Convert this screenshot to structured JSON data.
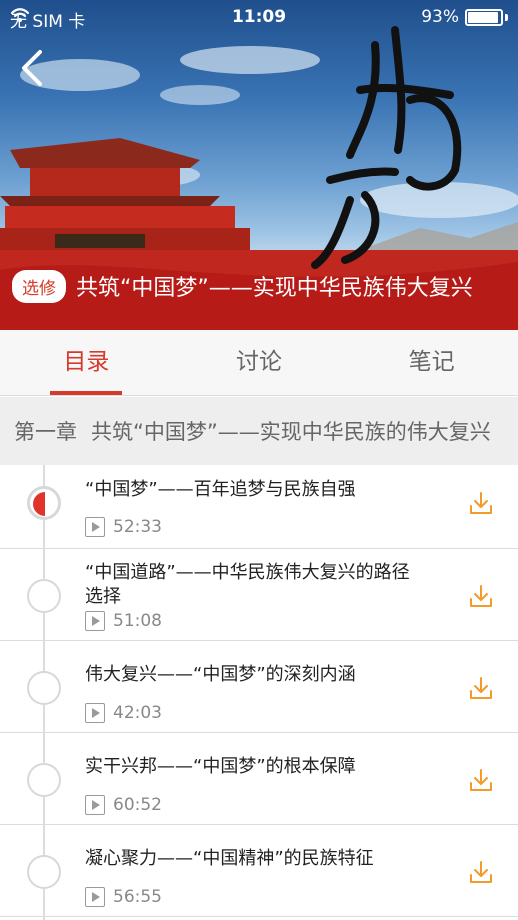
{
  "status_bar": {
    "carrier": "无 SIM 卡",
    "time": "11:09",
    "battery_percent": "93%",
    "battery_level": 0.93
  },
  "hero": {
    "badge": "选修",
    "course_title": "共筑“中国梦”——实现中华民族伟大复兴"
  },
  "tabs": [
    {
      "label": "目录",
      "active": true
    },
    {
      "label": "讨论",
      "active": false
    },
    {
      "label": "笔记",
      "active": false
    }
  ],
  "chapter": {
    "number": "第一章",
    "title": "共筑“中国梦”——实现中华民族的伟大复兴"
  },
  "lessons": [
    {
      "title": "“中国梦”——百年追梦与民族自强",
      "duration": "52:33",
      "in_progress": true
    },
    {
      "title": "“中国道路”——中华民族伟大复兴的路径选择",
      "duration": "51:08",
      "in_progress": false
    },
    {
      "title": "伟大复兴——“中国梦”的深刻内涵",
      "duration": "42:03",
      "in_progress": false
    },
    {
      "title": "实干兴邦——“中国梦”的根本保障",
      "duration": "60:52",
      "in_progress": false
    },
    {
      "title": "凝心聚力——“中国精神”的民族特征",
      "duration": "56:55",
      "in_progress": false
    }
  ],
  "colors": {
    "accent": "#d53a2a",
    "download": "#f39a2b"
  },
  "icons": [
    "wifi-icon",
    "battery-icon",
    "back-arrow-icon",
    "play-icon",
    "download-icon"
  ]
}
